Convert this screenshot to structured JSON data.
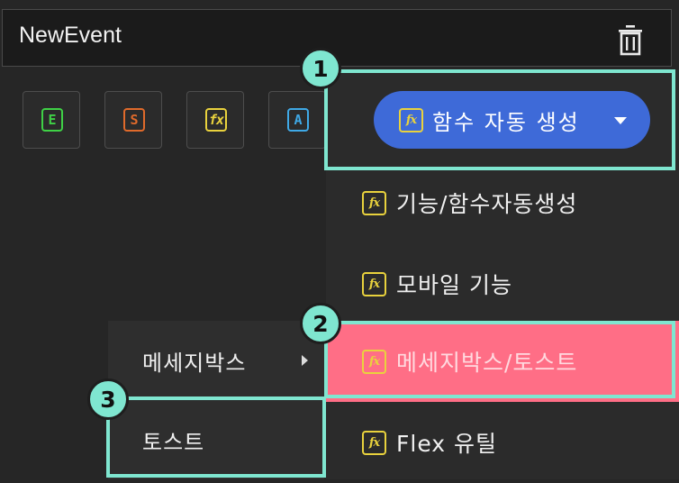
{
  "header": {
    "title": "NewEvent",
    "delete_icon": "trash-icon"
  },
  "toolbar": {
    "buttons": [
      {
        "letter": "E",
        "color": "#3fd146",
        "icon": "event-icon"
      },
      {
        "letter": "S",
        "color": "#e06a2b",
        "icon": "script-icon"
      },
      {
        "letter": "fx",
        "color": "#e9d23d",
        "icon": "function-icon"
      },
      {
        "letter": "A",
        "color": "#3fa9e6",
        "icon": "action-icon"
      }
    ]
  },
  "dropdown": {
    "selected_label": "함수 자동 생성",
    "accent": "#3e6ad8",
    "items": [
      {
        "label": "기능/함수자동생성"
      },
      {
        "label": "모바일 기능"
      },
      {
        "label": "메세지박스/토스트",
        "active": true,
        "active_color": "#ff6e86"
      },
      {
        "label": "Flex 유틸"
      }
    ]
  },
  "submenu": {
    "items": [
      {
        "label": "메세지박스",
        "has_submenu": true
      },
      {
        "label": "토스트"
      }
    ]
  },
  "annotations": {
    "color": "#7fe6d0",
    "markers": [
      "1",
      "2",
      "3"
    ]
  }
}
